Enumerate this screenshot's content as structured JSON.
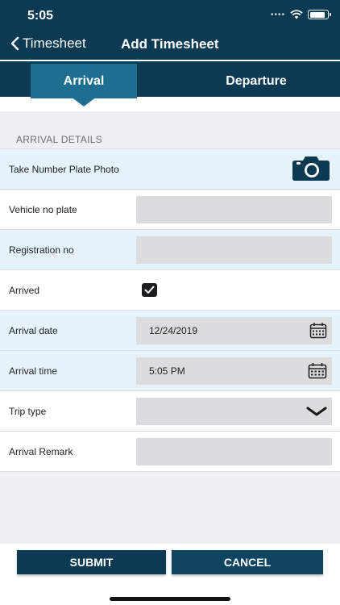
{
  "status_bar": {
    "time": "5:05",
    "signal_icon": "signal-dots-icon",
    "wifi_icon": "wifi-icon",
    "battery_icon": "battery-icon",
    "battery_level_percent": 90
  },
  "nav": {
    "back_label": "Timesheet",
    "title": "Add Timesheet"
  },
  "tabs": [
    {
      "label": "Arrival",
      "active": true
    },
    {
      "label": "Departure",
      "active": false
    }
  ],
  "section": {
    "label": "ARRIVAL DETAILS"
  },
  "form": {
    "photo": {
      "label": "Take Number Plate Photo",
      "icon": "camera-icon"
    },
    "vehicle_plate": {
      "label": "Vehicle no plate",
      "value": ""
    },
    "registration": {
      "label": "Registration no",
      "value": ""
    },
    "arrived": {
      "label": "Arrived",
      "checked": true
    },
    "arrival_date": {
      "label": "Arrival date",
      "value": "12/24/2019",
      "icon": "calendar-icon"
    },
    "arrival_time": {
      "label": "Arrival time",
      "value": "5:05 PM",
      "icon": "calendar-icon"
    },
    "trip_type": {
      "label": "Trip type",
      "value": "",
      "icon": "chevron-down-icon"
    },
    "arrival_remark": {
      "label": "Arrival Remark",
      "value": ""
    }
  },
  "buttons": {
    "submit": "SUBMIT",
    "cancel": "CANCEL"
  },
  "colors": {
    "header": "#0b3a52",
    "active_tab": "#1e6e92",
    "row_blue": "#e6f3fb",
    "field_gray": "#dcdcde"
  }
}
